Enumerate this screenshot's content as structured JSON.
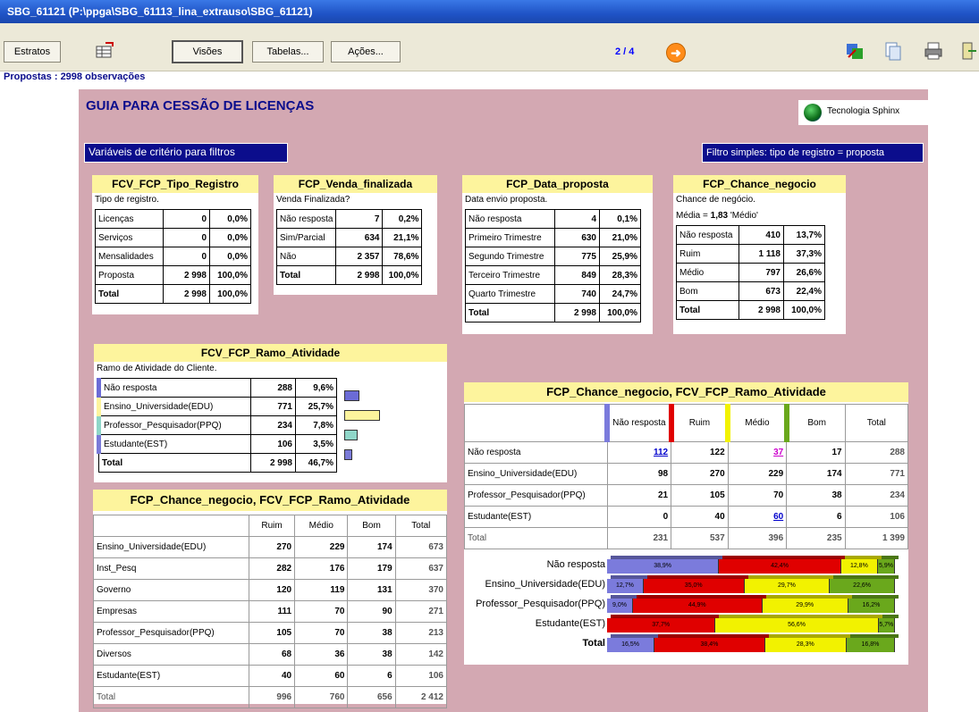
{
  "window": {
    "title": "SBG_61121 (P:\\ppga\\SBG_61113_lina_extrauso\\SBG_61121)"
  },
  "toolbar": {
    "estratos": "Estratos",
    "visoes": "Visões",
    "tabelas": "Tabelas...",
    "acoes": "Ações...",
    "page": "2 / 4",
    "observations": "Propostas : 2998 observações"
  },
  "doc": {
    "title": "GUIA PARA CESSÃO DE LICENÇAS",
    "logo_text": "Tecnologia Sphinx",
    "criteria_label": "Variáveis de critério para filtros",
    "filter_label": "Filtro simples: tipo de registro = proposta"
  },
  "tipo_registro": {
    "title": "FCV_FCP_Tipo_Registro",
    "subtitle": "Tipo de registro.",
    "rows": [
      {
        "label": "Licenças",
        "n": "0",
        "p": "0,0%"
      },
      {
        "label": "Serviços",
        "n": "0",
        "p": "0,0%"
      },
      {
        "label": "Mensalidades",
        "n": "0",
        "p": "0,0%"
      },
      {
        "label": "Proposta",
        "n": "2 998",
        "p": "100,0%"
      },
      {
        "label": "Total",
        "n": "2 998",
        "p": "100,0%"
      }
    ]
  },
  "venda": {
    "title": "FCP_Venda_finalizada",
    "subtitle": "Venda Finalizada?",
    "rows": [
      {
        "label": "Não resposta",
        "n": "7",
        "p": "0,2%"
      },
      {
        "label": "Sim/Parcial",
        "n": "634",
        "p": "21,1%"
      },
      {
        "label": "Não",
        "n": "2 357",
        "p": "78,6%"
      },
      {
        "label": "Total",
        "n": "2 998",
        "p": "100,0%"
      }
    ]
  },
  "data_proposta": {
    "title": "FCP_Data_proposta",
    "subtitle": "Data envio proposta.",
    "rows": [
      {
        "label": "Não resposta",
        "n": "4",
        "p": "0,1%"
      },
      {
        "label": "Primeiro Trimestre",
        "n": "630",
        "p": "21,0%"
      },
      {
        "label": "Segundo Trimestre",
        "n": "775",
        "p": "25,9%"
      },
      {
        "label": "Terceiro Trimestre",
        "n": "849",
        "p": "28,3%"
      },
      {
        "label": "Quarto Trimestre",
        "n": "740",
        "p": "24,7%"
      },
      {
        "label": "Total",
        "n": "2 998",
        "p": "100,0%"
      }
    ]
  },
  "chance": {
    "title": "FCP_Chance_negocio",
    "subtitle": "Chance de negócio.",
    "mean_prefix": "Média = ",
    "mean_value": "1,83",
    "mean_suffix": " 'Médio'",
    "rows": [
      {
        "label": "Não resposta",
        "n": "410",
        "p": "13,7%"
      },
      {
        "label": "Ruim",
        "n": "1 118",
        "p": "37,3%"
      },
      {
        "label": "Médio",
        "n": "797",
        "p": "26,6%"
      },
      {
        "label": "Bom",
        "n": "673",
        "p": "22,4%"
      },
      {
        "label": "Total",
        "n": "2 998",
        "p": "100,0%"
      }
    ]
  },
  "ramo": {
    "title": "FCV_FCP_Ramo_Atividade",
    "subtitle": "Ramo de Atividade do Cliente.",
    "rows": [
      {
        "label": "Não resposta",
        "n": "288",
        "p": "9,6%",
        "pct": 9.6,
        "color": "#6b6bd6"
      },
      {
        "label": "Ensino_Universidade(EDU)",
        "n": "771",
        "p": "25,7%",
        "pct": 25.7,
        "color": "#fdf49d"
      },
      {
        "label": "Professor_Pesquisador(PPQ)",
        "n": "234",
        "p": "7,8%",
        "pct": 7.8,
        "color": "#8fd6c8"
      },
      {
        "label": "Estudante(EST)",
        "n": "106",
        "p": "3,5%",
        "pct": 3.5,
        "color": "#7a7ad8"
      },
      {
        "label": "Total",
        "n": "2 998",
        "p": "46,7%"
      }
    ]
  },
  "cross_small": {
    "title": "FCP_Chance_negocio, FCV_FCP_Ramo_Atividade",
    "headers": [
      "",
      "Ruim",
      "Médio",
      "Bom",
      "Total"
    ],
    "rows": [
      [
        "Ensino_Universidade(EDU)",
        "270",
        "229",
        "174",
        "673"
      ],
      [
        "Inst_Pesq",
        "282",
        "176",
        "179",
        "637"
      ],
      [
        "Governo",
        "120",
        "119",
        "131",
        "370"
      ],
      [
        "Empresas",
        "111",
        "70",
        "90",
        "271"
      ],
      [
        "Professor_Pesquisador(PPQ)",
        "105",
        "70",
        "38",
        "213"
      ],
      [
        "Diversos",
        "68",
        "36",
        "38",
        "142"
      ],
      [
        "Estudante(EST)",
        "40",
        "60",
        "6",
        "106"
      ],
      [
        "Total",
        "996",
        "760",
        "656",
        "2 412"
      ]
    ]
  },
  "cross_big": {
    "title": "FCP_Chance_negocio, FCV_FCP_Ramo_Atividade",
    "headers": [
      "",
      "Não resposta",
      "Ruim",
      "Médio",
      "Bom",
      "Total"
    ],
    "header_colors": [
      "",
      "#7b7bdc",
      "#e00000",
      "#f2f200",
      "#6aa81c",
      ""
    ],
    "rows": [
      [
        "Não resposta",
        "112",
        "122",
        "37",
        "17",
        "288"
      ],
      [
        "Ensino_Universidade(EDU)",
        "98",
        "270",
        "229",
        "174",
        "771"
      ],
      [
        "Professor_Pesquisador(PPQ)",
        "21",
        "105",
        "70",
        "38",
        "234"
      ],
      [
        "Estudante(EST)",
        "0",
        "40",
        "60",
        "6",
        "106"
      ],
      [
        "Total",
        "231",
        "537",
        "396",
        "235",
        "1 399"
      ]
    ],
    "bars": [
      {
        "label": "Não resposta",
        "segs": [
          {
            "v": 38.9,
            "t": "38,9%"
          },
          {
            "v": 42.4,
            "t": "42,4%"
          },
          {
            "v": 12.8,
            "t": "12,8%"
          },
          {
            "v": 5.9,
            "t": "5,9%"
          }
        ]
      },
      {
        "label": "Ensino_Universidade(EDU)",
        "segs": [
          {
            "v": 12.7,
            "t": "12,7%"
          },
          {
            "v": 35.0,
            "t": "35,0%"
          },
          {
            "v": 29.7,
            "t": "29,7%"
          },
          {
            "v": 22.6,
            "t": "22,6%"
          }
        ]
      },
      {
        "label": "Professor_Pesquisador(PPQ)",
        "segs": [
          {
            "v": 9.0,
            "t": "9,0%"
          },
          {
            "v": 44.9,
            "t": "44,9%"
          },
          {
            "v": 29.9,
            "t": "29,9%"
          },
          {
            "v": 16.2,
            "t": "16,2%"
          }
        ]
      },
      {
        "label": "Estudante(EST)",
        "segs": [
          {
            "v": 0,
            "t": ""
          },
          {
            "v": 37.7,
            "t": "37,7%"
          },
          {
            "v": 56.6,
            "t": "56,6%"
          },
          {
            "v": 5.7,
            "t": "5,7%"
          }
        ]
      },
      {
        "label": "Total",
        "segs": [
          {
            "v": 16.5,
            "t": "16,5%"
          },
          {
            "v": 38.4,
            "t": "38,4%"
          },
          {
            "v": 28.3,
            "t": "28,3%"
          },
          {
            "v": 16.8,
            "t": "16,8%"
          }
        ]
      }
    ],
    "seg_colors": [
      "#7b7bdc",
      "#e00000",
      "#f2f200",
      "#6aa81c"
    ]
  }
}
